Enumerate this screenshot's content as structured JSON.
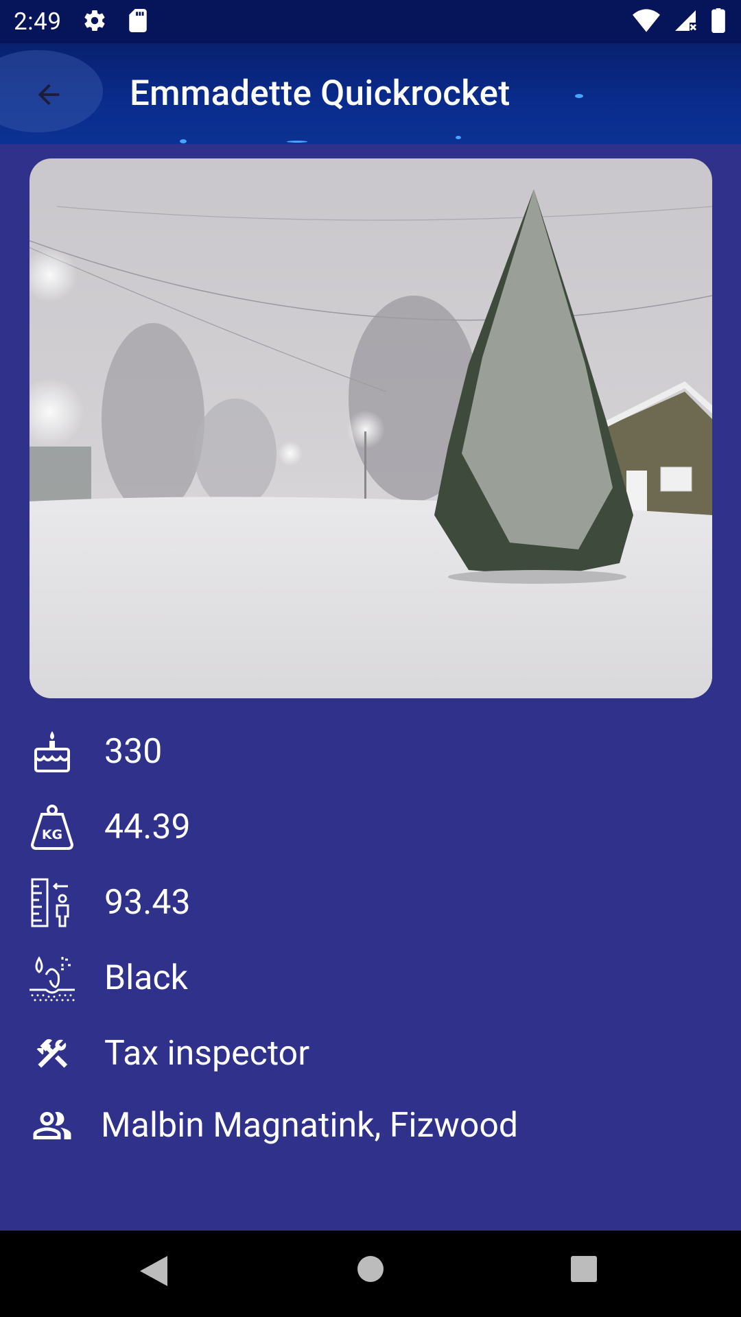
{
  "status_bar": {
    "time": "2:49",
    "icons": [
      "settings-icon",
      "sd-card-icon",
      "wifi-icon",
      "cell-signal-icon",
      "battery-icon"
    ]
  },
  "app_bar": {
    "title": "Emmadette Quickrocket",
    "back_icon": "arrow-back-icon"
  },
  "photo": {
    "subject": "snowy street at night with snow-covered pine tree"
  },
  "details": {
    "age": {
      "icon": "birthday-cake-icon",
      "value": "330"
    },
    "weight": {
      "icon": "weight-kg-icon",
      "value": "44.39"
    },
    "height": {
      "icon": "height-ruler-icon",
      "value": "93.43"
    },
    "hair_color": {
      "icon": "hair-icon",
      "value": "Black"
    },
    "profession": {
      "icon": "tools-icon",
      "value": "Tax inspector"
    },
    "friends": {
      "icon": "people-icon",
      "value": "Malbin Magnatink, Fizwood"
    }
  },
  "nav_bar": {
    "back_icon": "nav-back-triangle-icon",
    "home_icon": "nav-home-circle-icon",
    "recent_icon": "nav-recent-square-icon"
  },
  "colors": {
    "background": "#2f318a",
    "status_bar": "#06145a",
    "app_bar": "#0a2c8d"
  }
}
